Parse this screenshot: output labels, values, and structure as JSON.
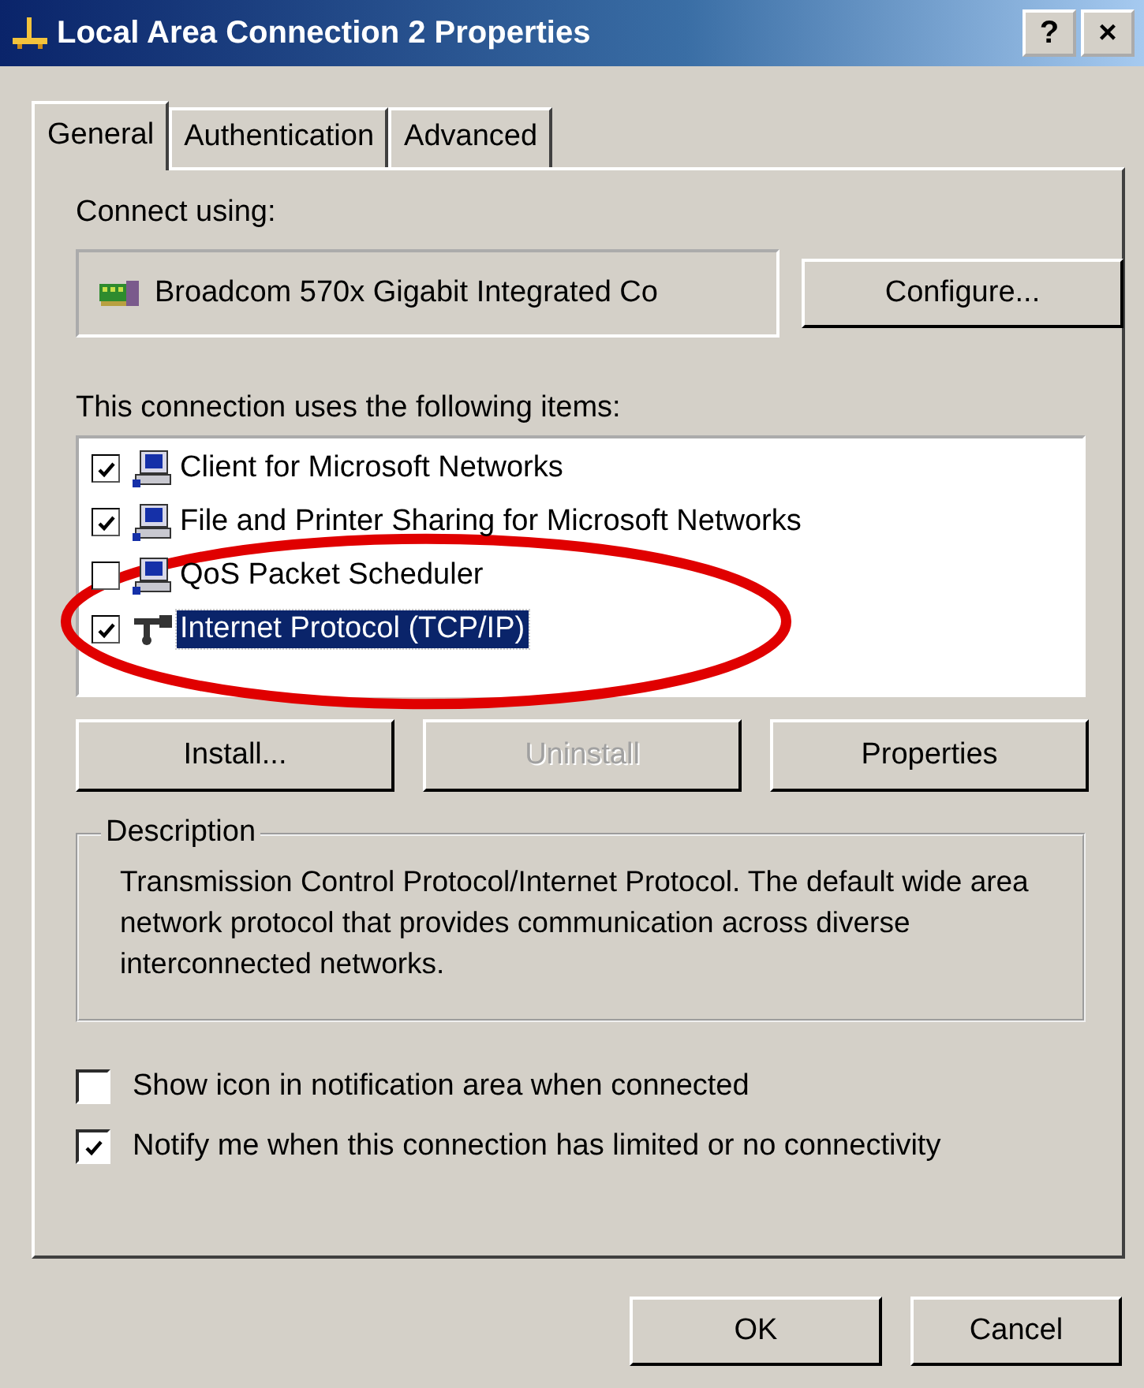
{
  "window": {
    "title": "Local Area Connection 2 Properties",
    "help_button": "?",
    "close_button": "×"
  },
  "tabs": [
    {
      "label": "General",
      "selected": true
    },
    {
      "label": "Authentication",
      "selected": false
    },
    {
      "label": "Advanced",
      "selected": false
    }
  ],
  "connect_using": {
    "label": "Connect using:",
    "adapter": "Broadcom 570x Gigabit Integrated Co",
    "button": "Configure..."
  },
  "items_label": "This connection uses the following items:",
  "items": [
    {
      "label": "Client for Microsoft Networks",
      "kind": "computer",
      "checked": true,
      "selected": false
    },
    {
      "label": "File and Printer Sharing for Microsoft Networks",
      "kind": "computer",
      "checked": true,
      "selected": false
    },
    {
      "label": "QoS Packet Scheduler",
      "kind": "computer",
      "checked": false,
      "selected": false
    },
    {
      "label": "Internet Protocol (TCP/IP)",
      "kind": "protocol",
      "checked": true,
      "selected": true
    }
  ],
  "item_buttons": [
    {
      "label": "Install...",
      "disabled": false
    },
    {
      "label": "Uninstall",
      "disabled": true
    },
    {
      "label": "Properties",
      "disabled": false
    }
  ],
  "description": {
    "title": "Description",
    "text": "Transmission Control Protocol/Internet Protocol. The default wide area network protocol that provides communication across diverse interconnected networks."
  },
  "options": [
    {
      "label": "Show icon in notification area when connected",
      "checked": false
    },
    {
      "label": "Notify me when this connection has limited or no connectivity",
      "checked": true
    }
  ],
  "dialog_buttons": [
    "OK",
    "Cancel"
  ],
  "annotation": {
    "kind": "ellipse"
  }
}
